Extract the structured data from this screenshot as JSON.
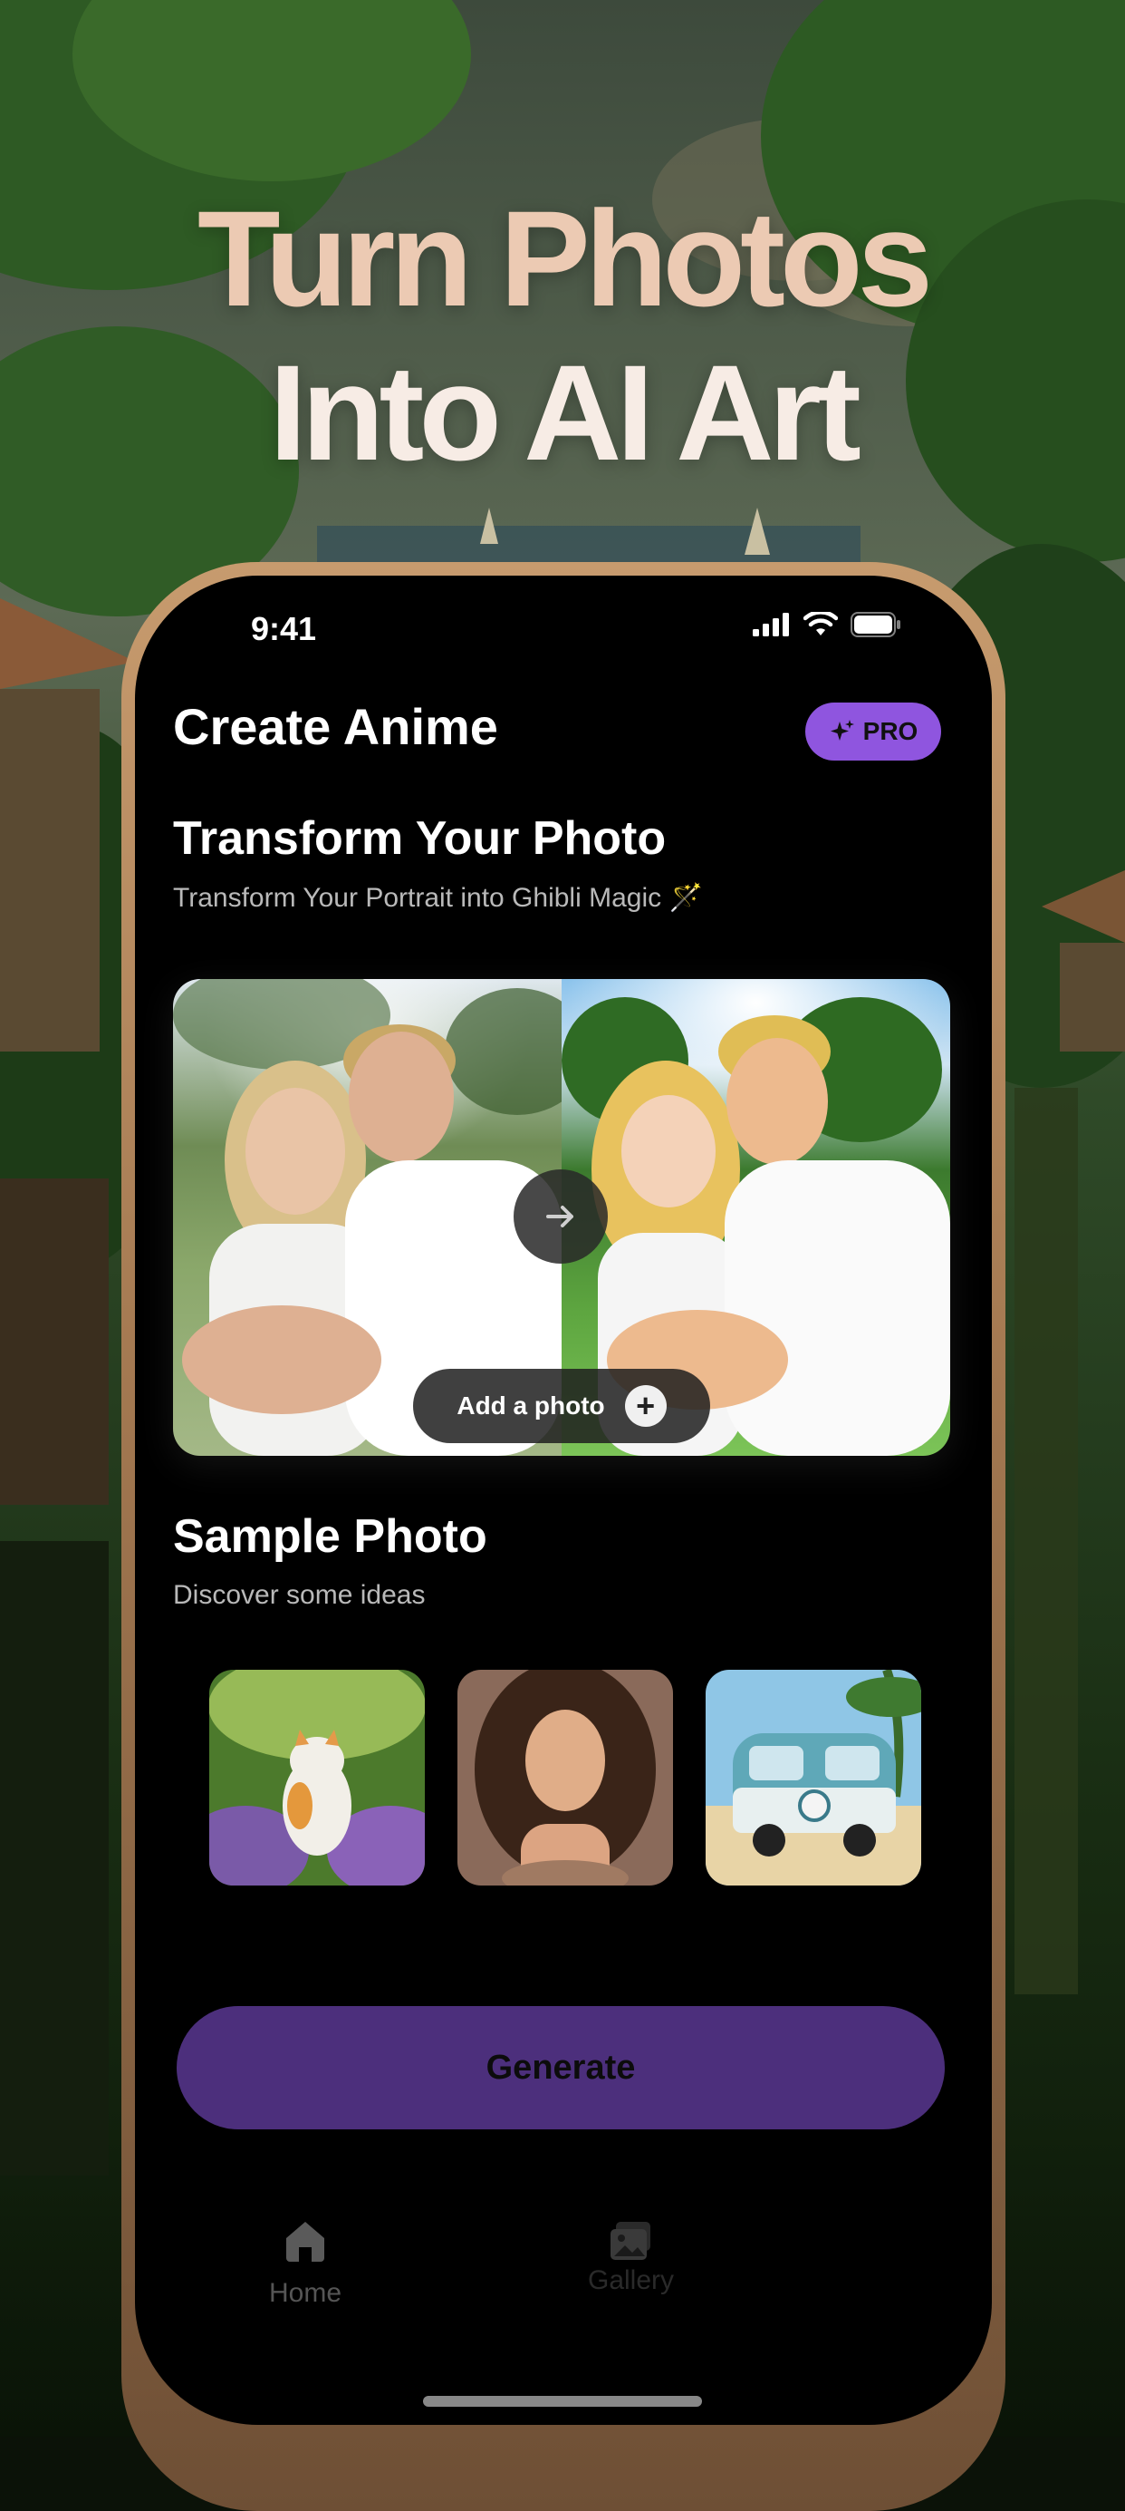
{
  "headline": {
    "line1": "Turn Photos",
    "line2": "Into AI Art"
  },
  "status_bar": {
    "time": "9:41"
  },
  "header": {
    "title": "Create Anime",
    "pro_label": "PRO"
  },
  "transform": {
    "title": "Transform Your Photo",
    "subtitle": "Transform Your Portrait into Ghibli Magic 🪄",
    "add_photo_label": "Add a photo"
  },
  "samples": {
    "title": "Sample Photo",
    "subtitle": "Discover some ideas",
    "items": [
      "cat-in-garden",
      "curly-hair-woman",
      "blue-camper-van"
    ]
  },
  "generate_label": "Generate",
  "tabs": [
    {
      "label": "Home",
      "icon": "home-icon"
    },
    {
      "label": "Gallery",
      "icon": "gallery-icon"
    }
  ],
  "colors": {
    "accent": "#8f55df",
    "generate_button": "#4c2f7c",
    "screen_bg": "#000000",
    "frame": "#b5875d"
  }
}
